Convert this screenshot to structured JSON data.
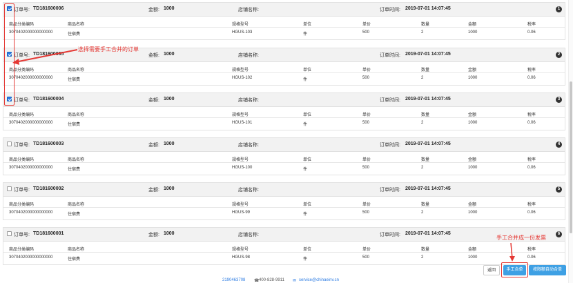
{
  "labels": {
    "order_no": "订单号:",
    "amount": "金额:",
    "shop": "店铺名称:",
    "order_time": "订单时间:"
  },
  "columns": [
    "商品分类编码",
    "商品名称",
    "规格型号",
    "单位",
    "单价",
    "数量",
    "金额",
    "税率"
  ],
  "orders": [
    {
      "order_no": "TD181600006",
      "amount": "1000",
      "shop": "",
      "time": "2019-07-01 14:07:45",
      "index": "1",
      "checked": true,
      "item": {
        "code": "3070402000000000000",
        "name": "住宿费",
        "spec": "HGUS-103",
        "unit": "件",
        "price": "500",
        "qty": "2",
        "amount": "1000",
        "tax": "0.06"
      }
    },
    {
      "order_no": "TD181600005",
      "amount": "1000",
      "shop": "",
      "time": "2019-07-01 14:07:45",
      "index": "2",
      "checked": true,
      "item": {
        "code": "3070402000000000000",
        "name": "住宿费",
        "spec": "HGUS-102",
        "unit": "件",
        "price": "500",
        "qty": "2",
        "amount": "1000",
        "tax": "0.06"
      }
    },
    {
      "order_no": "TD181600004",
      "amount": "1000",
      "shop": "",
      "time": "2019-07-01 14:07:45",
      "index": "3",
      "checked": true,
      "item": {
        "code": "3070402000000000000",
        "name": "住宿费",
        "spec": "HGUS-101",
        "unit": "件",
        "price": "500",
        "qty": "2",
        "amount": "1000",
        "tax": "0.06"
      }
    },
    {
      "order_no": "TD181600003",
      "amount": "1000",
      "shop": "",
      "time": "2019-07-01 14:07:45",
      "index": "4",
      "checked": false,
      "item": {
        "code": "3070402000000000000",
        "name": "住宿费",
        "spec": "HGUS-100",
        "unit": "件",
        "price": "500",
        "qty": "2",
        "amount": "1000",
        "tax": "0.06"
      }
    },
    {
      "order_no": "TD181600002",
      "amount": "1000",
      "shop": "",
      "time": "2019-07-01 14:07:45",
      "index": "5",
      "checked": false,
      "item": {
        "code": "3070402000000000000",
        "name": "住宿费",
        "spec": "HGUS-99",
        "unit": "件",
        "price": "500",
        "qty": "2",
        "amount": "1000",
        "tax": "0.06"
      }
    },
    {
      "order_no": "TD181600001",
      "amount": "1000",
      "shop": "",
      "time": "2019-07-01 14:07:45",
      "index": "6",
      "checked": false,
      "item": {
        "code": "3070402000000000000",
        "name": "住宿费",
        "spec": "HGUS-98",
        "unit": "件",
        "price": "500",
        "qty": "2",
        "amount": "1000",
        "tax": "0.06"
      }
    }
  ],
  "annotations": {
    "select_note": "选择需要手工合并的订单",
    "merge_note": "手工合并成一份发票"
  },
  "buttons": {
    "back": "返回",
    "manual_merge": "手工合单",
    "auto_merge": "按限额自动合单"
  },
  "footer": {
    "qq": "2190463708",
    "phone": "400-828-9911",
    "email": "service@chinaeinv.cn"
  },
  "colors": {
    "accent": "#3ea0e4",
    "annotation": "#e53935",
    "header_bg": "#f2f2f2"
  }
}
